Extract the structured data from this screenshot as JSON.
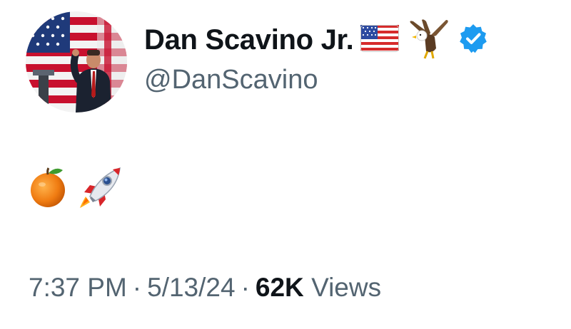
{
  "author": {
    "display_name": "Dan Scavino Jr.",
    "handle": "@DanScavino",
    "name_emojis": [
      "us-flag-icon",
      "eagle-icon"
    ],
    "verified_icon": "verified-badge-icon",
    "verified_color": "#1d9bf0"
  },
  "tweet": {
    "emojis": [
      "tangerine-icon",
      "rocket-icon"
    ]
  },
  "meta": {
    "time": "7:37 PM",
    "separator": "·",
    "date": "5/13/24",
    "views_count": "62K",
    "views_label": "Views"
  },
  "colors": {
    "secondary_text": "#536471",
    "primary_text": "#0f1419"
  }
}
